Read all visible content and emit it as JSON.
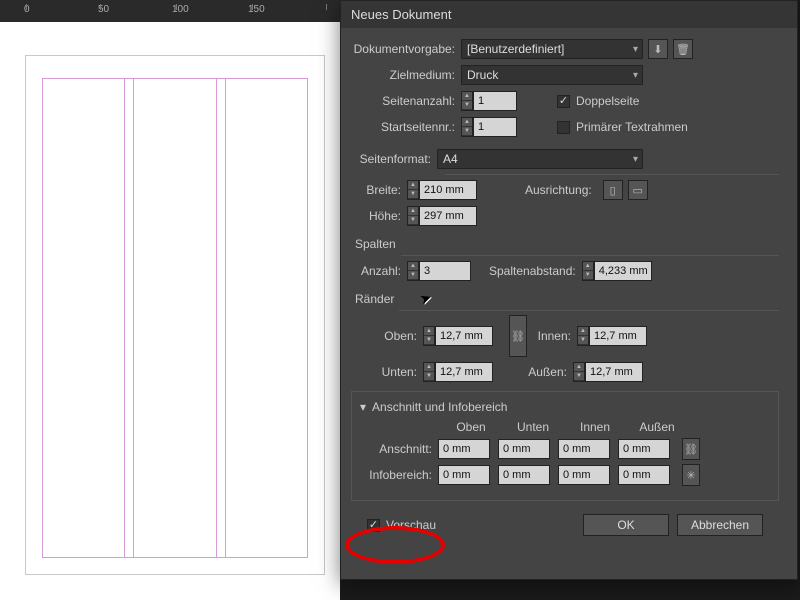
{
  "ruler_marks": [
    "0",
    "50",
    "100",
    "150"
  ],
  "dialog": {
    "title": "Neues Dokument",
    "preset_label": "Dokumentvorgabe:",
    "preset_value": "[Benutzerdefiniert]",
    "intent_label": "Zielmedium:",
    "intent_value": "Druck",
    "pages_label": "Seitenanzahl:",
    "pages_value": "1",
    "facing_label": "Doppelseite",
    "facing_checked": true,
    "startpage_label": "Startseitennr.:",
    "startpage_value": "1",
    "primarytf_label": "Primärer Textrahmen",
    "primarytf_checked": false,
    "pageformat_label": "Seitenformat:",
    "pageformat_value": "A4",
    "width_label": "Breite:",
    "width_value": "210 mm",
    "height_label": "Höhe:",
    "height_value": "297 mm",
    "orientation_label": "Ausrichtung:",
    "columns_legend": "Spalten",
    "columns_count_label": "Anzahl:",
    "columns_count_value": "3",
    "gutter_label": "Spaltenabstand:",
    "gutter_value": "4,233 mm",
    "margins_legend": "Ränder",
    "top_label": "Oben:",
    "top_value": "12,7 mm",
    "bottom_label": "Unten:",
    "bottom_value": "12,7 mm",
    "inside_label": "Innen:",
    "inside_value": "12,7 mm",
    "outside_label": "Außen:",
    "outside_value": "12,7 mm",
    "bleed_legend": "Anschnitt und Infobereich",
    "bleed_heads": [
      "Oben",
      "Unten",
      "Innen",
      "Außen"
    ],
    "bleed_label": "Anschnitt:",
    "bleed_vals": [
      "0 mm",
      "0 mm",
      "0 mm",
      "0 mm"
    ],
    "slug_label": "Infobereich:",
    "slug_vals": [
      "0 mm",
      "0 mm",
      "0 mm",
      "0 mm"
    ],
    "preview_label": "Vorschau",
    "ok_label": "OK",
    "cancel_label": "Abbrechen"
  }
}
